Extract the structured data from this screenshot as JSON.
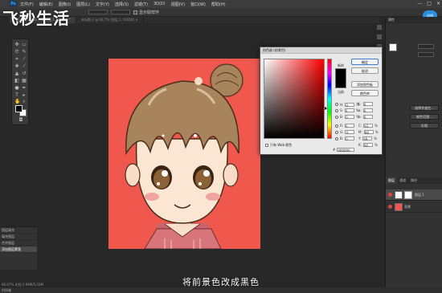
{
  "watermark": "飞秒生活",
  "caption": "将前景色改成黑色",
  "menu": {
    "logo": "Ps",
    "items": [
      "文件(F)",
      "编辑(E)",
      "图像(I)",
      "图层(L)",
      "文字(Y)",
      "选择(S)",
      "滤镜(T)",
      "3D(D)",
      "视图(V)",
      "窗口(W)",
      "帮助(H)"
    ],
    "window_controls": [
      "—",
      "□",
      "✕"
    ]
  },
  "options_bar": {
    "checkbox_label": "显示取样环",
    "badge": "选择"
  },
  "tabs": [
    {
      "label": "未标题-1 @ 66.7% (图层 1, RGB/8) *",
      "active": true
    },
    {
      "label": "未标题-2 @ 66.7% (图层 1, RGB/8) ×",
      "active": false
    }
  ],
  "history": {
    "rows": [
      "图层填充",
      "填充图层",
      "合并图层",
      "添加图层蒙版"
    ],
    "selected_index": 3
  },
  "status": {
    "zoom_doc": "66.67%    文档:1.94M/5.03M",
    "bottom": "时间轴"
  },
  "color_picker": {
    "title": "拾色器 (前景色)",
    "new_label": "新的",
    "current_label": "当前",
    "buttons": [
      "确定",
      "取消",
      "添加到色板",
      "颜色库"
    ],
    "hsb": [
      {
        "label": "H:",
        "value": "0",
        "unit": "度",
        "checked": true
      },
      {
        "label": "S:",
        "value": "0",
        "unit": "%",
        "checked": false
      },
      {
        "label": "B:",
        "value": "0",
        "unit": "%",
        "checked": false
      }
    ],
    "rgb": [
      {
        "label": "R:",
        "value": "0",
        "checked": false
      },
      {
        "label": "G:",
        "value": "0",
        "checked": false
      },
      {
        "label": "B:",
        "value": "0",
        "checked": false
      }
    ],
    "lab": [
      {
        "label": "L:",
        "value": "0"
      },
      {
        "label": "a:",
        "value": "0"
      },
      {
        "label": "b:",
        "value": "0"
      }
    ],
    "cmyk": [
      {
        "label": "C:",
        "value": "93",
        "unit": "%"
      },
      {
        "label": "M:",
        "value": "88",
        "unit": "%"
      },
      {
        "label": "Y:",
        "value": "89",
        "unit": "%"
      },
      {
        "label": "K:",
        "value": "80",
        "unit": "%"
      }
    ],
    "web_only_label": "只有 Web 颜色",
    "hex_prefix": "#",
    "hex_value": "000000",
    "new_color": "#000000"
  },
  "right_panel": {
    "head": "属性",
    "buttons": [
      "选择并遮住...",
      "颜色范围...",
      "反相"
    ],
    "layers_tabs": [
      "图层",
      "通道",
      "路径"
    ],
    "layers": [
      {
        "name": "图层 1",
        "selected": true,
        "thumb_color": "#ffffff"
      },
      {
        "name": "背景",
        "selected": false,
        "thumb_color": "#f0584e"
      }
    ]
  },
  "colors": {
    "canvas_bg": "#f0584e",
    "foreground": "#000000",
    "background": "#ffffff"
  }
}
